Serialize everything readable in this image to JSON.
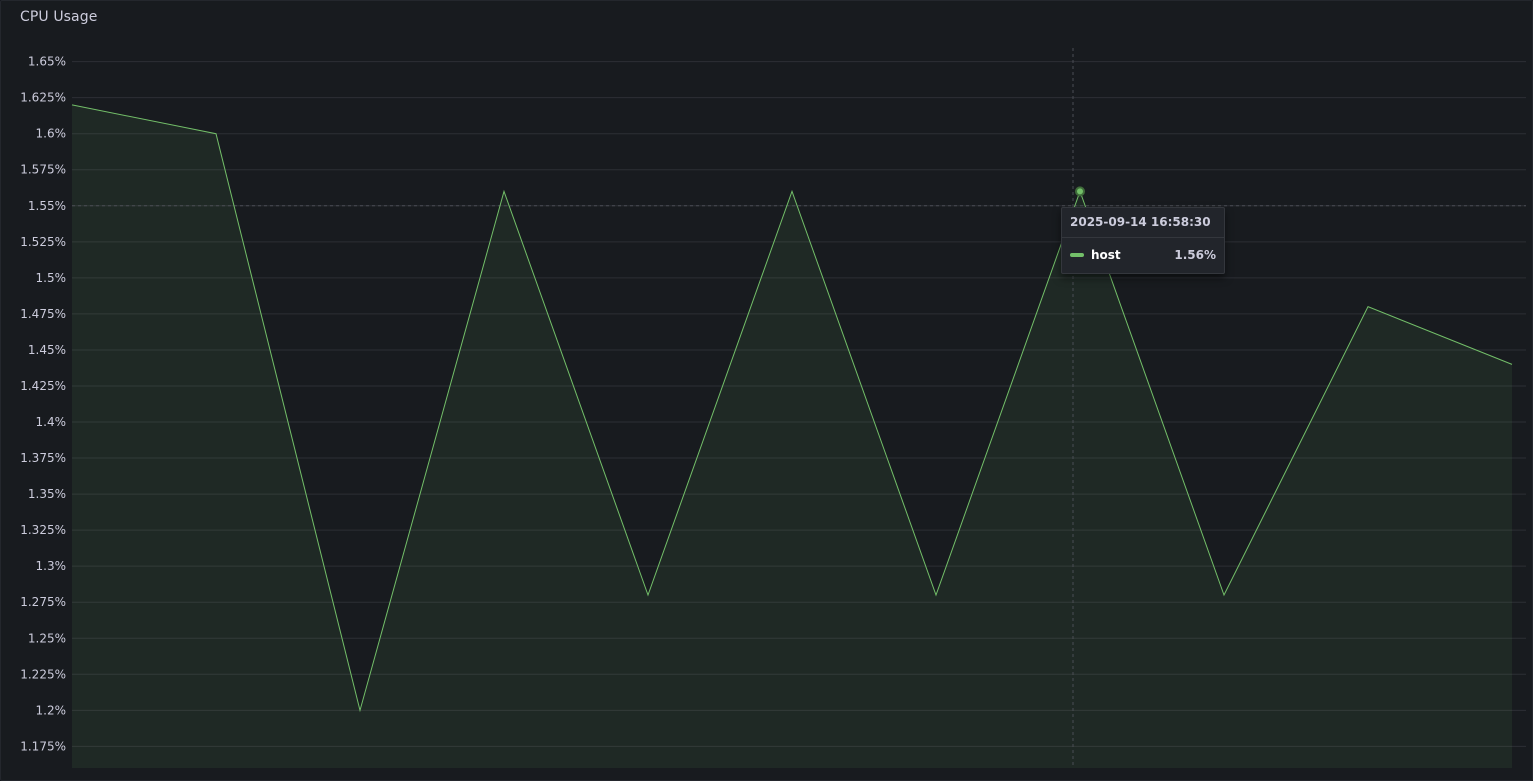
{
  "panel": {
    "title": "CPU Usage"
  },
  "colors": {
    "series_line": "#73bf69",
    "grid": "#2c2f35",
    "background": "#181b1f",
    "text": "#ccccdc"
  },
  "chart_data": {
    "type": "area",
    "title": "CPU Usage",
    "xlabel": "",
    "ylabel": "",
    "ylim": [
      1.16,
      1.665
    ],
    "yticks": [
      1.175,
      1.2,
      1.225,
      1.25,
      1.275,
      1.3,
      1.325,
      1.35,
      1.375,
      1.4,
      1.425,
      1.45,
      1.475,
      1.5,
      1.525,
      1.55,
      1.575,
      1.6,
      1.625,
      1.65
    ],
    "ytick_labels": [
      "1.175%",
      "1.2%",
      "1.225%",
      "1.25%",
      "1.275%",
      "1.3%",
      "1.325%",
      "1.35%",
      "1.375%",
      "1.4%",
      "1.425%",
      "1.45%",
      "1.475%",
      "1.5%",
      "1.525%",
      "1.55%",
      "1.575%",
      "1.6%",
      "1.625%",
      "1.65%"
    ],
    "grid": true,
    "x_axis_visible": false,
    "series": [
      {
        "name": "host",
        "color": "#73bf69",
        "values": [
          1.62,
          1.6,
          1.2,
          1.56,
          1.28,
          1.56,
          1.28,
          1.56,
          1.28,
          1.48,
          1.44
        ]
      }
    ],
    "hover": {
      "index": 7,
      "crosshair_value": 1.55
    }
  },
  "tooltip": {
    "timestamp": "2025-09-14 16:58:30",
    "series_name": "host",
    "value": "1.56%"
  }
}
